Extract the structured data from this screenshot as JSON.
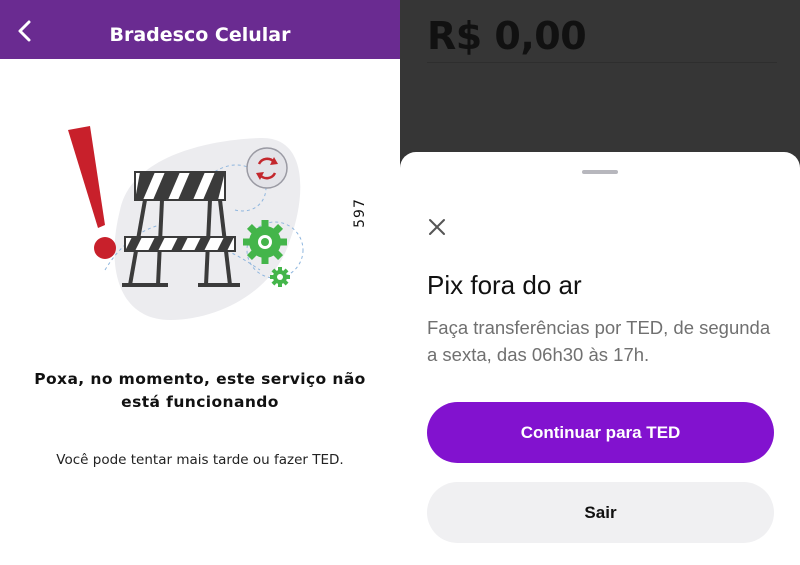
{
  "left_screen": {
    "header": {
      "title": "Bradesco Celular",
      "back_icon": "chevron-left-icon",
      "bg_color": "#6a2b91"
    },
    "illustration": {
      "name": "maintenance-barrier-illustration"
    },
    "side_code": "597",
    "error": {
      "title_line1": "Poxa, no momento, este serviço não",
      "title_line2": "está funcionando",
      "subtitle": "Você pode tentar mais tarde ou fazer TED."
    }
  },
  "right_screen": {
    "balance": "R$ 0,00",
    "sheet": {
      "close_icon": "close-icon",
      "title": "Pix fora do ar",
      "description": "Faça transferências por TED, de segunda a sexta, das 06h30 às 17h.",
      "primary_button": "Continuar para TED",
      "secondary_button": "Sair",
      "accent_color": "#8212cf"
    }
  }
}
